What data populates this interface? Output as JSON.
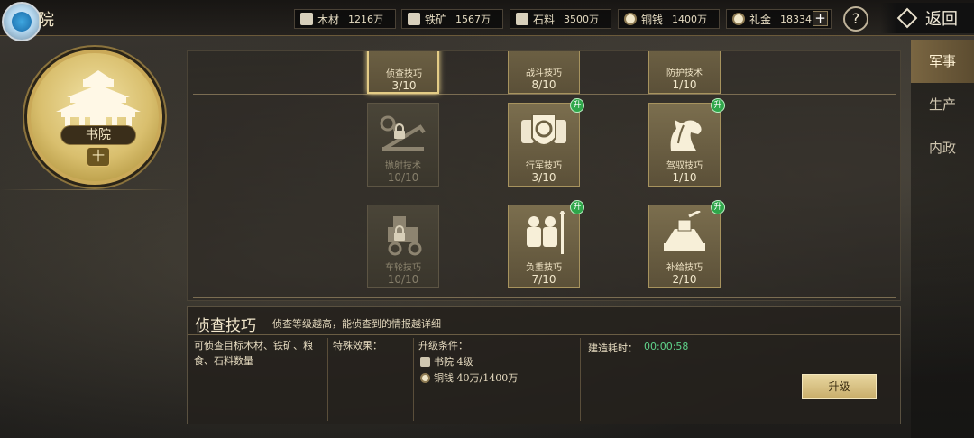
{
  "header": {
    "title_fragment": "院",
    "resources": [
      {
        "icon": "wood-icon",
        "label": "木材",
        "value": "1216万"
      },
      {
        "icon": "iron-ore-icon",
        "label": "铁矿",
        "value": "1567万"
      },
      {
        "icon": "stone-icon",
        "label": "石料",
        "value": "3500万"
      },
      {
        "icon": "copper-coin-icon",
        "label": "铜钱",
        "value": "1400万"
      },
      {
        "icon": "gift-gold-icon",
        "label": "礼金",
        "value": "18334"
      }
    ],
    "plus_label": "+",
    "help_label": "?",
    "back_label": "返回"
  },
  "side_tabs": [
    {
      "label": "军事",
      "active": true
    },
    {
      "label": "生产",
      "active": false
    },
    {
      "label": "内政",
      "active": false
    }
  ],
  "building": {
    "name": "书院",
    "plus_label": "十"
  },
  "skills": [
    {
      "name": "侦查技巧",
      "level": "3/10",
      "locked": false,
      "upgradable": false,
      "selected": true
    },
    {
      "name": "战斗技巧",
      "level": "8/10",
      "locked": false,
      "upgradable": false,
      "selected": false
    },
    {
      "name": "防护技术",
      "level": "1/10",
      "locked": false,
      "upgradable": false,
      "selected": false
    },
    {
      "name": "抛射技术",
      "level": "10/10",
      "locked": true,
      "upgradable": false,
      "selected": false
    },
    {
      "name": "行军技巧",
      "level": "3/10",
      "locked": false,
      "upgradable": true,
      "selected": false
    },
    {
      "name": "驾驭技巧",
      "level": "1/10",
      "locked": false,
      "upgradable": true,
      "selected": false
    },
    {
      "name": "车轮技巧",
      "level": "10/10",
      "locked": true,
      "upgradable": false,
      "selected": false
    },
    {
      "name": "负重技巧",
      "level": "7/10",
      "locked": false,
      "upgradable": true,
      "selected": false
    },
    {
      "name": "补给技巧",
      "level": "2/10",
      "locked": false,
      "upgradable": true,
      "selected": false
    }
  ],
  "upgrade_badge": "升",
  "detail": {
    "title": "侦查技巧",
    "subtitle": "侦查等级越高，能侦查到的情报越详细",
    "description": "可侦查目标木材、铁矿、粮食、石料数量",
    "effect_label": "特殊效果：",
    "conditions_label": "升级条件：",
    "conditions": [
      {
        "icon": "academy-icon",
        "text": "书院 4级"
      },
      {
        "icon": "copper-coin-icon",
        "text": "铜钱 40万/1400万"
      }
    ],
    "time_label": "建造耗时：",
    "time_value": "00:00:58",
    "upgrade_label": "升级"
  },
  "colors": {
    "accent_gold": "#c9ae6a",
    "upgrade_badge": "#2fa64a",
    "timer_green": "#5fd28a"
  }
}
